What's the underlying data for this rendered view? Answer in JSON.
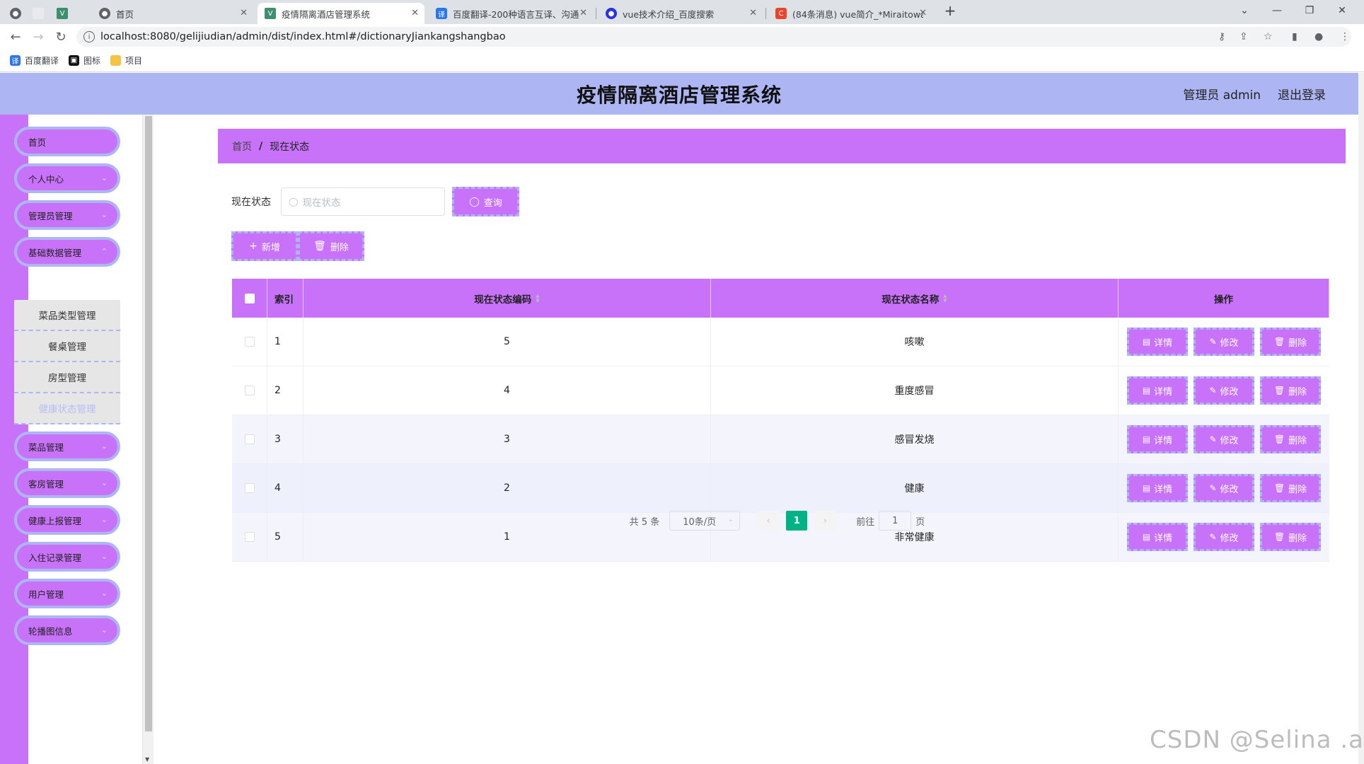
{
  "browser": {
    "tabs": [
      {
        "title": "首页",
        "active": false
      },
      {
        "title": "疫情隔离酒店管理系统",
        "active": true
      },
      {
        "title": "百度翻译-200种语言互译、沟通",
        "active": false
      },
      {
        "title": "vue技术介绍_百度搜索",
        "active": false
      },
      {
        "title": "(84条消息) vue简介_*Miraitowa",
        "active": false
      }
    ],
    "url": "localhost:8080/gelijiudian/admin/dist/index.html#/dictionaryJiankangshangbao",
    "bookmarks": [
      "百度翻译",
      "图标",
      "项目"
    ]
  },
  "header": {
    "title": "疫情隔离酒店管理系统",
    "user": "管理员 admin",
    "logout": "退出登录"
  },
  "sidebar": {
    "items": [
      {
        "label": "首页",
        "has_sub": false
      },
      {
        "label": "个人中心",
        "has_sub": true
      },
      {
        "label": "管理员管理",
        "has_sub": true
      },
      {
        "label": "基础数据管理",
        "has_sub": true
      },
      {
        "label": "菜品管理",
        "has_sub": true
      },
      {
        "label": "客房管理",
        "has_sub": true
      },
      {
        "label": "健康上报管理",
        "has_sub": true
      },
      {
        "label": "入住记录管理",
        "has_sub": true
      },
      {
        "label": "用户管理",
        "has_sub": true
      },
      {
        "label": "轮播图信息",
        "has_sub": true
      }
    ],
    "submenu": [
      {
        "label": "菜品类型管理",
        "active": false
      },
      {
        "label": "餐桌管理",
        "active": false
      },
      {
        "label": "房型管理",
        "active": false
      },
      {
        "label": "健康状态管理",
        "active": true
      }
    ]
  },
  "breadcrumb": {
    "home": "首页",
    "current": "现在状态"
  },
  "search": {
    "label": "现在状态",
    "placeholder": "现在状态",
    "button": "查询"
  },
  "actions": {
    "add": "新增",
    "delete": "删除"
  },
  "table": {
    "headers": {
      "index": "索引",
      "code": "现在状态编码",
      "name": "现在状态名称",
      "ops": "操作"
    },
    "rows": [
      {
        "index": "1",
        "code": "5",
        "name": "咳嗽"
      },
      {
        "index": "2",
        "code": "4",
        "name": "重度感冒"
      },
      {
        "index": "3",
        "code": "3",
        "name": "感冒发烧"
      },
      {
        "index": "4",
        "code": "2",
        "name": "健康"
      },
      {
        "index": "5",
        "code": "1",
        "name": "非常健康"
      }
    ],
    "row_buttons": {
      "detail": "详情",
      "edit": "修改",
      "delete": "删除"
    }
  },
  "pagination": {
    "total": "共 5 条",
    "page_size": "10条/页",
    "current_page": "1",
    "goto_label": "前往",
    "goto_value": "1",
    "goto_suffix": "页"
  },
  "watermark": "CSDN @Selina .a",
  "colors": {
    "accent": "#c872fa",
    "header": "#adb6f3",
    "page_active": "#00b386"
  }
}
